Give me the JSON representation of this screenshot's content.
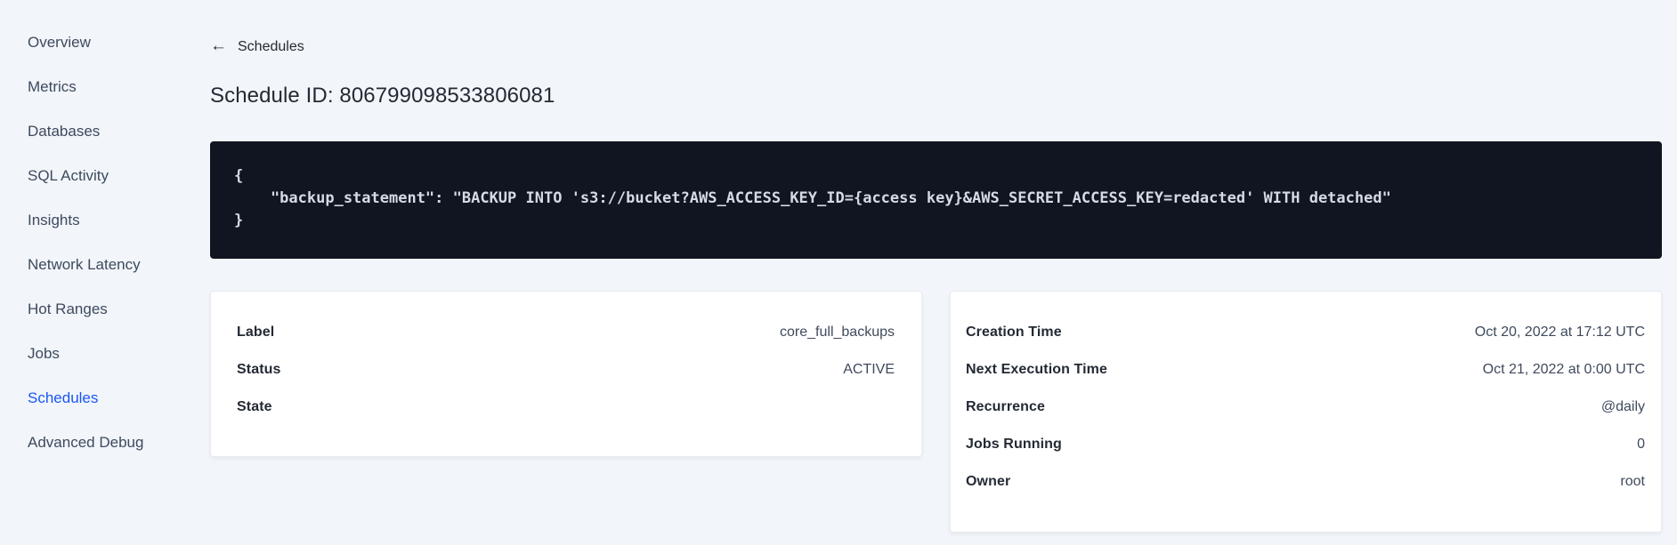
{
  "sidebar": {
    "items": [
      {
        "label": "Overview",
        "active": false
      },
      {
        "label": "Metrics",
        "active": false
      },
      {
        "label": "Databases",
        "active": false
      },
      {
        "label": "SQL Activity",
        "active": false
      },
      {
        "label": "Insights",
        "active": false
      },
      {
        "label": "Network Latency",
        "active": false
      },
      {
        "label": "Hot Ranges",
        "active": false
      },
      {
        "label": "Jobs",
        "active": false
      },
      {
        "label": "Schedules",
        "active": true
      },
      {
        "label": "Advanced Debug",
        "active": false
      }
    ]
  },
  "header": {
    "back_icon": "←",
    "back_label": "Schedules",
    "title": "Schedule ID: 806799098533806081"
  },
  "code_block": {
    "lines": [
      "{",
      "    \"backup_statement\": \"BACKUP INTO 's3://bucket?AWS_ACCESS_KEY_ID={access key}&AWS_SECRET_ACCESS_KEY=redacted' WITH detached\"",
      "}"
    ]
  },
  "details_card": {
    "rows": [
      {
        "label": "Label",
        "value": "core_full_backups"
      },
      {
        "label": "Status",
        "value": "ACTIVE"
      },
      {
        "label": "State",
        "value": ""
      }
    ]
  },
  "schedule_card": {
    "rows": [
      {
        "label": "Creation Time",
        "value": "Oct 20, 2022 at 17:12 UTC"
      },
      {
        "label": "Next Execution Time",
        "value": "Oct 21, 2022 at 0:00 UTC"
      },
      {
        "label": "Recurrence",
        "value": "@daily"
      },
      {
        "label": "Jobs Running",
        "value": "0"
      },
      {
        "label": "Owner",
        "value": "root"
      }
    ]
  },
  "colors": {
    "accent_blue": "#1a56f4",
    "page_bg": "#f2f5f9",
    "code_bg": "#111522",
    "code_text": "#d5dae3",
    "text_primary": "#242a35",
    "text_secondary": "#3f4a5c"
  }
}
